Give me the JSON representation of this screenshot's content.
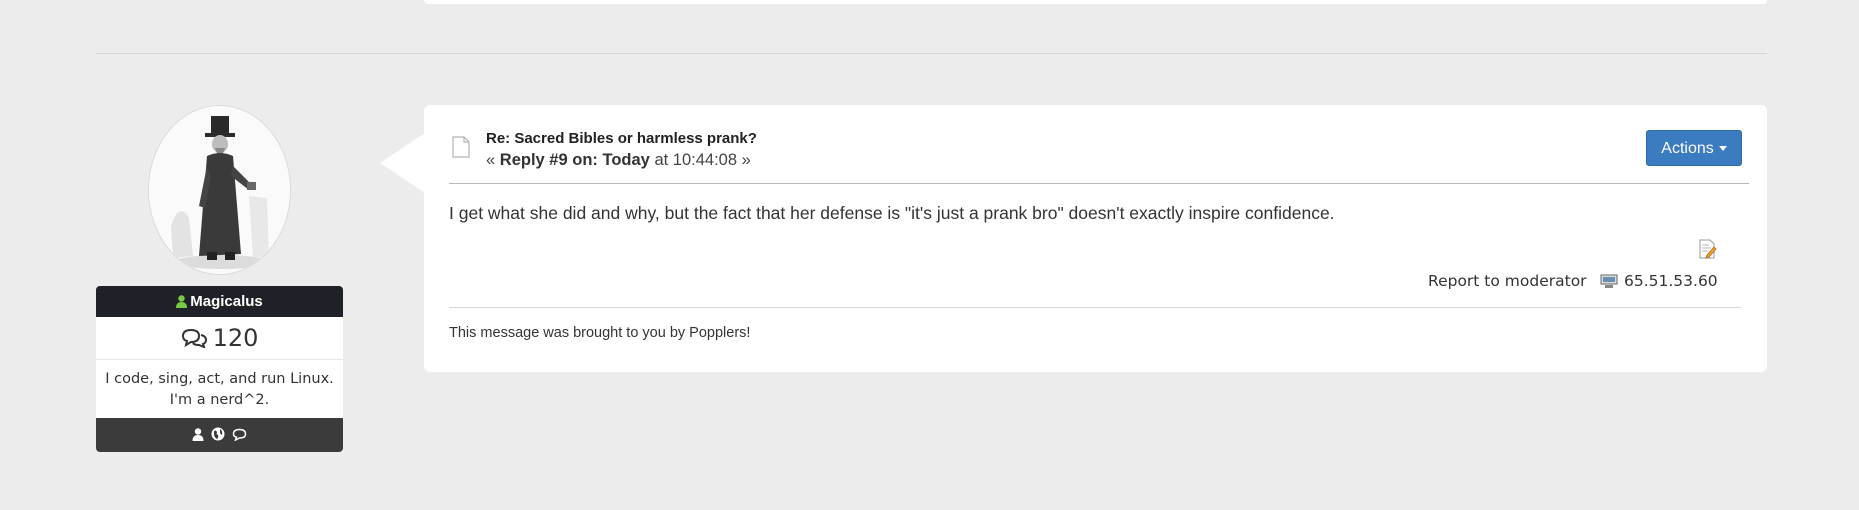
{
  "post": {
    "subject": "Re: Sacred Bibles or harmless prank?",
    "reply_prefix": "«",
    "reply_label": "Reply #9 on:",
    "reply_day": "Today",
    "reply_time": "at 10:44:08",
    "reply_suffix": "»",
    "actions_label": "Actions",
    "body": "I get what she did and why, but the fact that her defense is \"it's just a prank bro\" doesn't exactly inspire confidence.",
    "report_label": "Report to moderator",
    "ip": "65.51.53.60",
    "signature": "This message was brought to you by Popplers!"
  },
  "poster": {
    "name": "Magicalus",
    "post_count": "120",
    "blurb_line1": "I code, sing, act, and run Linux.",
    "blurb_line2": "I'm a nerd^2.",
    "online_color": "#7ac943",
    "link_icons": [
      "profile-icon",
      "website-icon",
      "message-icon"
    ]
  },
  "colors": {
    "accent": "#3b7bbf",
    "name_bar": "#1e2127",
    "links_bar": "#3b3b3b"
  }
}
